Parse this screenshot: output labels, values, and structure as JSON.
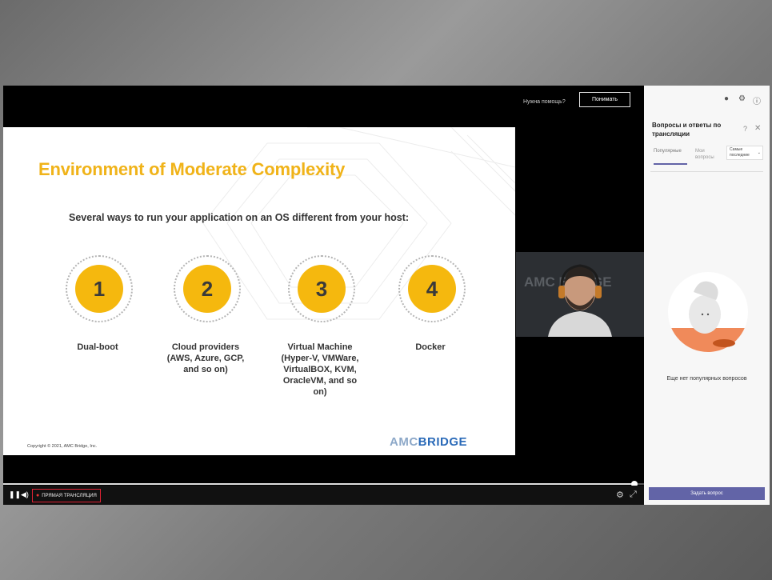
{
  "topbar": {
    "help_text": "Нужна помощь?",
    "understand_label": "Понимать"
  },
  "slide": {
    "title": "Environment of Moderate Complexity",
    "subtitle": "Several ways to run your application on an OS different from your host:",
    "ways": [
      {
        "number": "1",
        "label": "Dual-boot"
      },
      {
        "number": "2",
        "label": "Cloud providers (AWS, Azure, GCP, and so on)"
      },
      {
        "number": "3",
        "label": "Virtual Machine (Hyper-V, VMWare, VirtualBOX, KVM, OracleVM, and so on)"
      },
      {
        "number": "4",
        "label": "Docker"
      }
    ],
    "copyright": "Copyright © 2021, AMC Bridge, Inc.",
    "logo_amc": "AMC",
    "logo_bridge": "BRIDGE",
    "accent_color": "#f5b80e",
    "title_color": "#f0b319"
  },
  "webcam": {
    "background_logo": "AMC BRIDGE"
  },
  "player": {
    "live_label": "ПРЯМАЯ ТРАНСЛЯЦИЯ",
    "progress": 0.985,
    "icons": {
      "pause": "pause-icon",
      "volume": "volume-icon",
      "settings": "gear-icon",
      "fullscreen": "expand-icon"
    }
  },
  "panel": {
    "title": "Вопросы и ответы по трансляции",
    "tabs": [
      {
        "label": "Популярные"
      },
      {
        "label": "Мои вопросы"
      }
    ],
    "sort_label": "Самые последние",
    "empty_text": "Еще нет популярных вопросов",
    "ask_button": "Задать вопрос",
    "accent_color": "#6264a7"
  }
}
